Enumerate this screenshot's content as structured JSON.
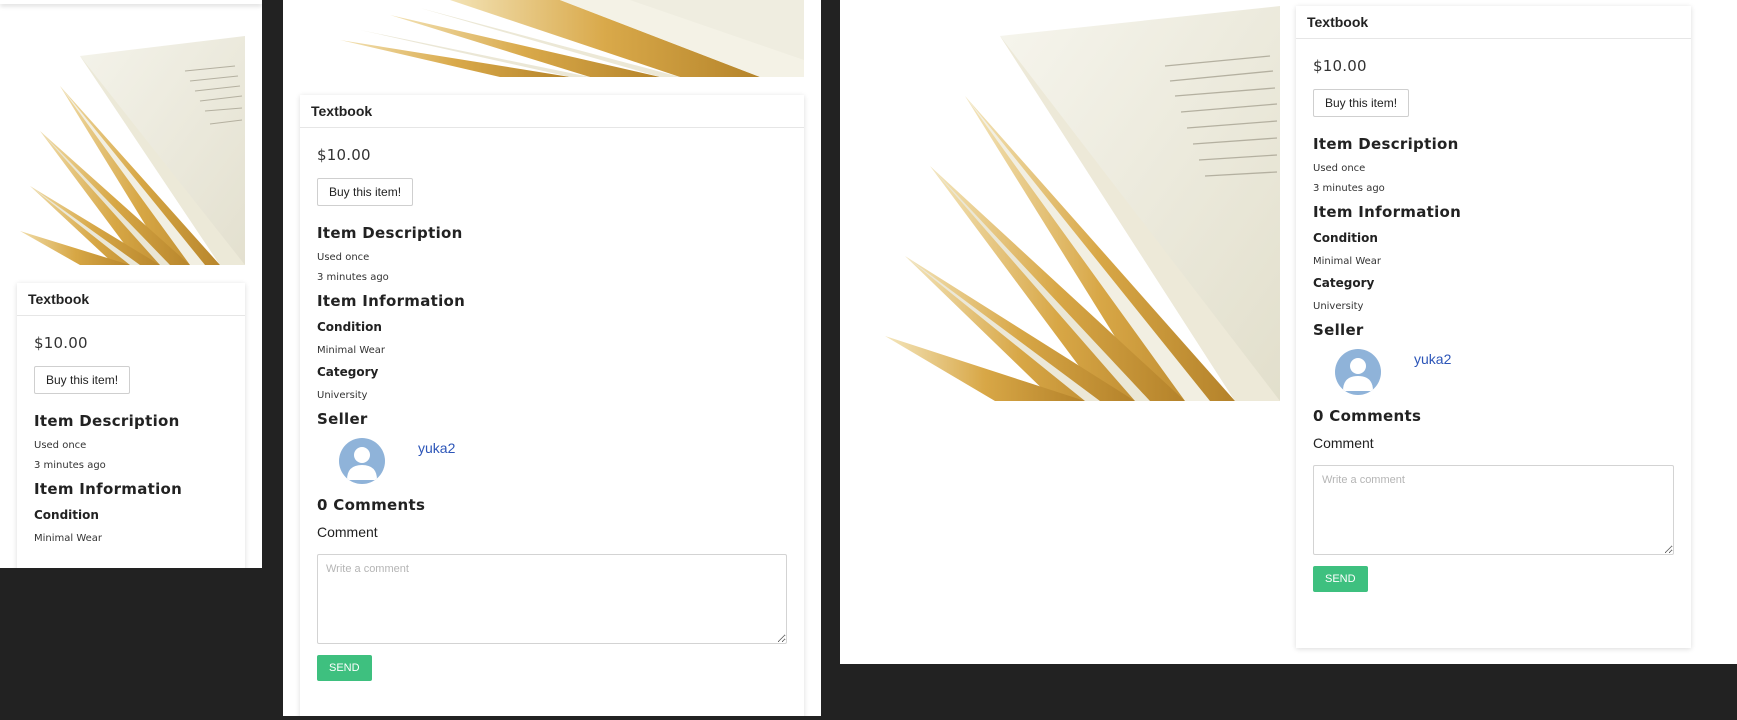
{
  "item": {
    "title": "Textbook",
    "price": "$10.00",
    "buy_label": "Buy this item!",
    "description_heading": "Item Description",
    "description": "Used once",
    "posted": "3 minutes ago",
    "info_heading": "Item Information",
    "condition_label": "Condition",
    "condition_value": "Minimal Wear",
    "category_label": "Category",
    "category_value": "University",
    "seller_heading": "Seller",
    "seller_name": "yuka2",
    "comments_heading": "0 Comments",
    "comment_label": "Comment",
    "comment_placeholder": "Write a comment",
    "send_label": "SEND"
  },
  "icons": {
    "avatar": "user-avatar-icon"
  },
  "colors": {
    "page_bg": "#222222",
    "link": "#2c55b8",
    "send_button": "#3ec07f",
    "avatar_bg": "#8fb3d9"
  }
}
